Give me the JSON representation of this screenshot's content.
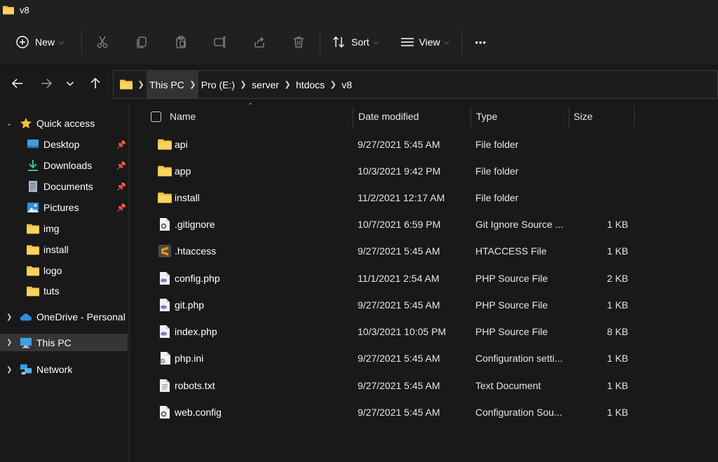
{
  "window": {
    "title": "v8"
  },
  "toolbar": {
    "new_label": "New",
    "sort_label": "Sort",
    "view_label": "View",
    "more_label": "•••"
  },
  "address": {
    "crumbs": [
      "This PC",
      "Pro (E:)",
      "server",
      "htdocs",
      "v8"
    ]
  },
  "sidebar": {
    "items": [
      {
        "label": "Quick access",
        "icon": "star-icon"
      },
      {
        "label": "Desktop",
        "icon": "desktop-icon"
      },
      {
        "label": "Downloads",
        "icon": "download-icon"
      },
      {
        "label": "Documents",
        "icon": "document-icon"
      },
      {
        "label": "Pictures",
        "icon": "pictures-icon"
      },
      {
        "label": "img",
        "icon": "folder-icon"
      },
      {
        "label": "install",
        "icon": "folder-icon"
      },
      {
        "label": "logo",
        "icon": "folder-icon"
      },
      {
        "label": "tuts",
        "icon": "folder-icon"
      },
      {
        "label": "OneDrive - Personal",
        "icon": "cloud-icon"
      },
      {
        "label": "This PC",
        "icon": "computer-icon"
      },
      {
        "label": "Network",
        "icon": "network-icon"
      }
    ]
  },
  "columns": {
    "name": "Name",
    "date": "Date modified",
    "type": "Type",
    "size": "Size"
  },
  "files": [
    {
      "name": "api",
      "date": "9/27/2021 5:45 AM",
      "type": "File folder",
      "size": "",
      "icon": "folder-icon"
    },
    {
      "name": "app",
      "date": "10/3/2021 9:42 PM",
      "type": "File folder",
      "size": "",
      "icon": "folder-icon"
    },
    {
      "name": "install",
      "date": "11/2/2021 12:17 AM",
      "type": "File folder",
      "size": "",
      "icon": "folder-icon"
    },
    {
      "name": ".gitignore",
      "date": "10/7/2021 6:59 PM",
      "type": "Git Ignore Source ...",
      "size": "1 KB",
      "icon": "gear-file-icon"
    },
    {
      "name": ".htaccess",
      "date": "9/27/2021 5:45 AM",
      "type": "HTACCESS File",
      "size": "1 KB",
      "icon": "sublime-file-icon"
    },
    {
      "name": "config.php",
      "date": "11/1/2021 2:54 AM",
      "type": "PHP Source File",
      "size": "2 KB",
      "icon": "php-file-icon"
    },
    {
      "name": "git.php",
      "date": "9/27/2021 5:45 AM",
      "type": "PHP Source File",
      "size": "1 KB",
      "icon": "php-file-icon"
    },
    {
      "name": "index.php",
      "date": "10/3/2021 10:05 PM",
      "type": "PHP Source File",
      "size": "8 KB",
      "icon": "php-file-icon"
    },
    {
      "name": "php.ini",
      "date": "9/27/2021 5:45 AM",
      "type": "Configuration setti...",
      "size": "1 KB",
      "icon": "settings-file-icon"
    },
    {
      "name": "robots.txt",
      "date": "9/27/2021 5:45 AM",
      "type": "Text Document",
      "size": "1 KB",
      "icon": "text-file-icon"
    },
    {
      "name": "web.config",
      "date": "9/27/2021 5:45 AM",
      "type": "Configuration Sou...",
      "size": "1 KB",
      "icon": "gear-file-icon"
    }
  ],
  "colors": {
    "folder": "#f3c246",
    "background": "#191919",
    "chrome": "#202020",
    "selection": "#353535"
  }
}
